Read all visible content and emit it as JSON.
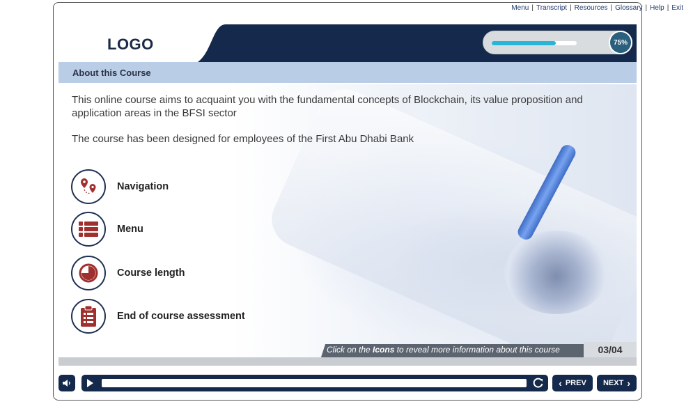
{
  "top_nav": {
    "items": [
      "Menu",
      "Transcript",
      "Resources",
      "Glossary",
      "Help",
      "Exit"
    ]
  },
  "header": {
    "logo": "LOGO",
    "progress_percent_label": "75%",
    "progress_fraction": 0.75
  },
  "page": {
    "title": "About this Course",
    "intro_1": "This online course aims to acquaint you with the fundamental concepts of Blockchain, its value proposition and application areas in the BFSI sector",
    "intro_2": "The course has been designed for employees of the First Abu Dhabi Bank",
    "icons": [
      {
        "label": "Navigation",
        "icon": "map-pins-icon"
      },
      {
        "label": "Menu",
        "icon": "list-icon"
      },
      {
        "label": "Course length",
        "icon": "pie-chart-icon"
      },
      {
        "label": "End of course assessment",
        "icon": "clipboard-icon"
      }
    ],
    "hint_prefix": "Click on the ",
    "hint_bold": "Icons",
    "hint_suffix": " to reveal more information about this course",
    "page_number": "03/04"
  },
  "controls": {
    "prev_label": "PREV",
    "next_label": "NEXT",
    "prev_icon": "‹",
    "next_icon": "›"
  },
  "colors": {
    "navy": "#14294b",
    "accent_red": "#a0302f",
    "progress": "#27b6d8",
    "title_band": "#b9cde6"
  }
}
